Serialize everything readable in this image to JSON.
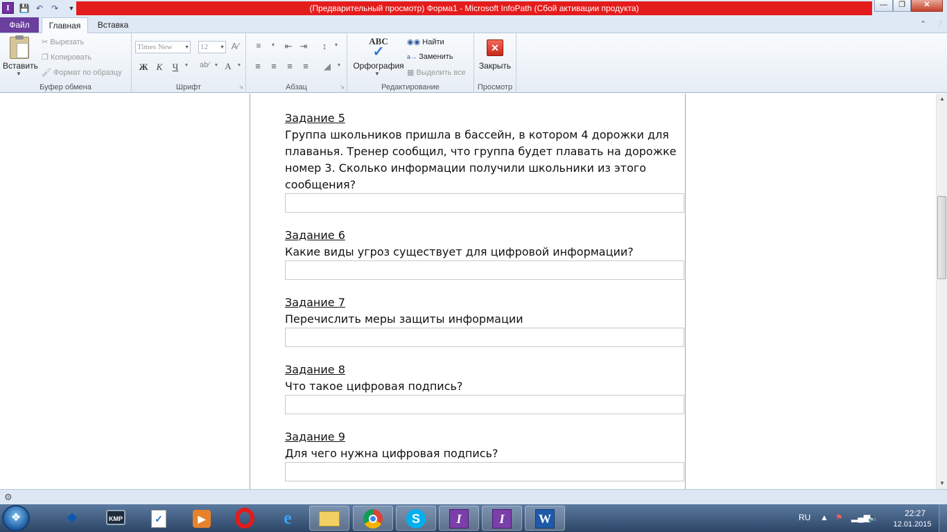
{
  "titlebar": {
    "title": "(Предварительный просмотр) Форма1  -  Microsoft InfoPath (Сбой активации продукта)",
    "title_bg": "#e51c1c"
  },
  "tabs": [
    {
      "label": "Файл",
      "color": "#6b3f9e"
    },
    {
      "label": "Главная",
      "active": true
    },
    {
      "label": "Вставка"
    }
  ],
  "ribbon": {
    "clipboard": {
      "paste": "Вставить",
      "cut": "Вырезать",
      "copy": "Копировать",
      "format_painter": "Формат по образцу",
      "label": "Буфер обмена"
    },
    "font": {
      "font_name": "Times New Roman",
      "font_size": "12",
      "bold": "Ж",
      "italic": "К",
      "underline": "Ч",
      "font_color": "A",
      "label": "Шрифт"
    },
    "paragraph": {
      "label": "Абзац"
    },
    "editing": {
      "spelling": "Орфография",
      "find": "Найти",
      "replace": "Заменить",
      "select_all": "Выделить все",
      "label": "Редактирование"
    },
    "preview": {
      "close": "Закрыть",
      "label": "Просмотр"
    }
  },
  "tasks": [
    {
      "title": "Задание 5",
      "text": "Группа школьников пришла в бассейн, в котором 4 дорожки для плаванья. Тренер сообщил, что группа будет плавать на дорожке номер 3. Сколько информации получили школьники из этого сообщения?",
      "answer": ""
    },
    {
      "title": "Задание 6",
      "text": "Какие виды угроз существует для цифровой информации?",
      "answer": ""
    },
    {
      "title": "Задание 7",
      "text": "Перечислить меры защиты информации",
      "answer": ""
    },
    {
      "title": "Задание 8",
      "text": "Что такое цифровая подпись?",
      "answer": ""
    },
    {
      "title": "Задание 9",
      "text": "Для чего нужна цифровая подпись?",
      "answer": ""
    }
  ],
  "taskbar": {
    "apps": [
      "bluetooth-icon",
      "kmplayer-icon",
      "tasks-icon",
      "media-player-icon",
      "opera-icon",
      "internet-explorer-icon",
      "file-explorer-icon",
      "chrome-icon",
      "skype-icon",
      "infopath-icon",
      "infopath-icon",
      "word-icon"
    ],
    "language": "RU",
    "time": "22:27",
    "date": "12.01.2015"
  }
}
